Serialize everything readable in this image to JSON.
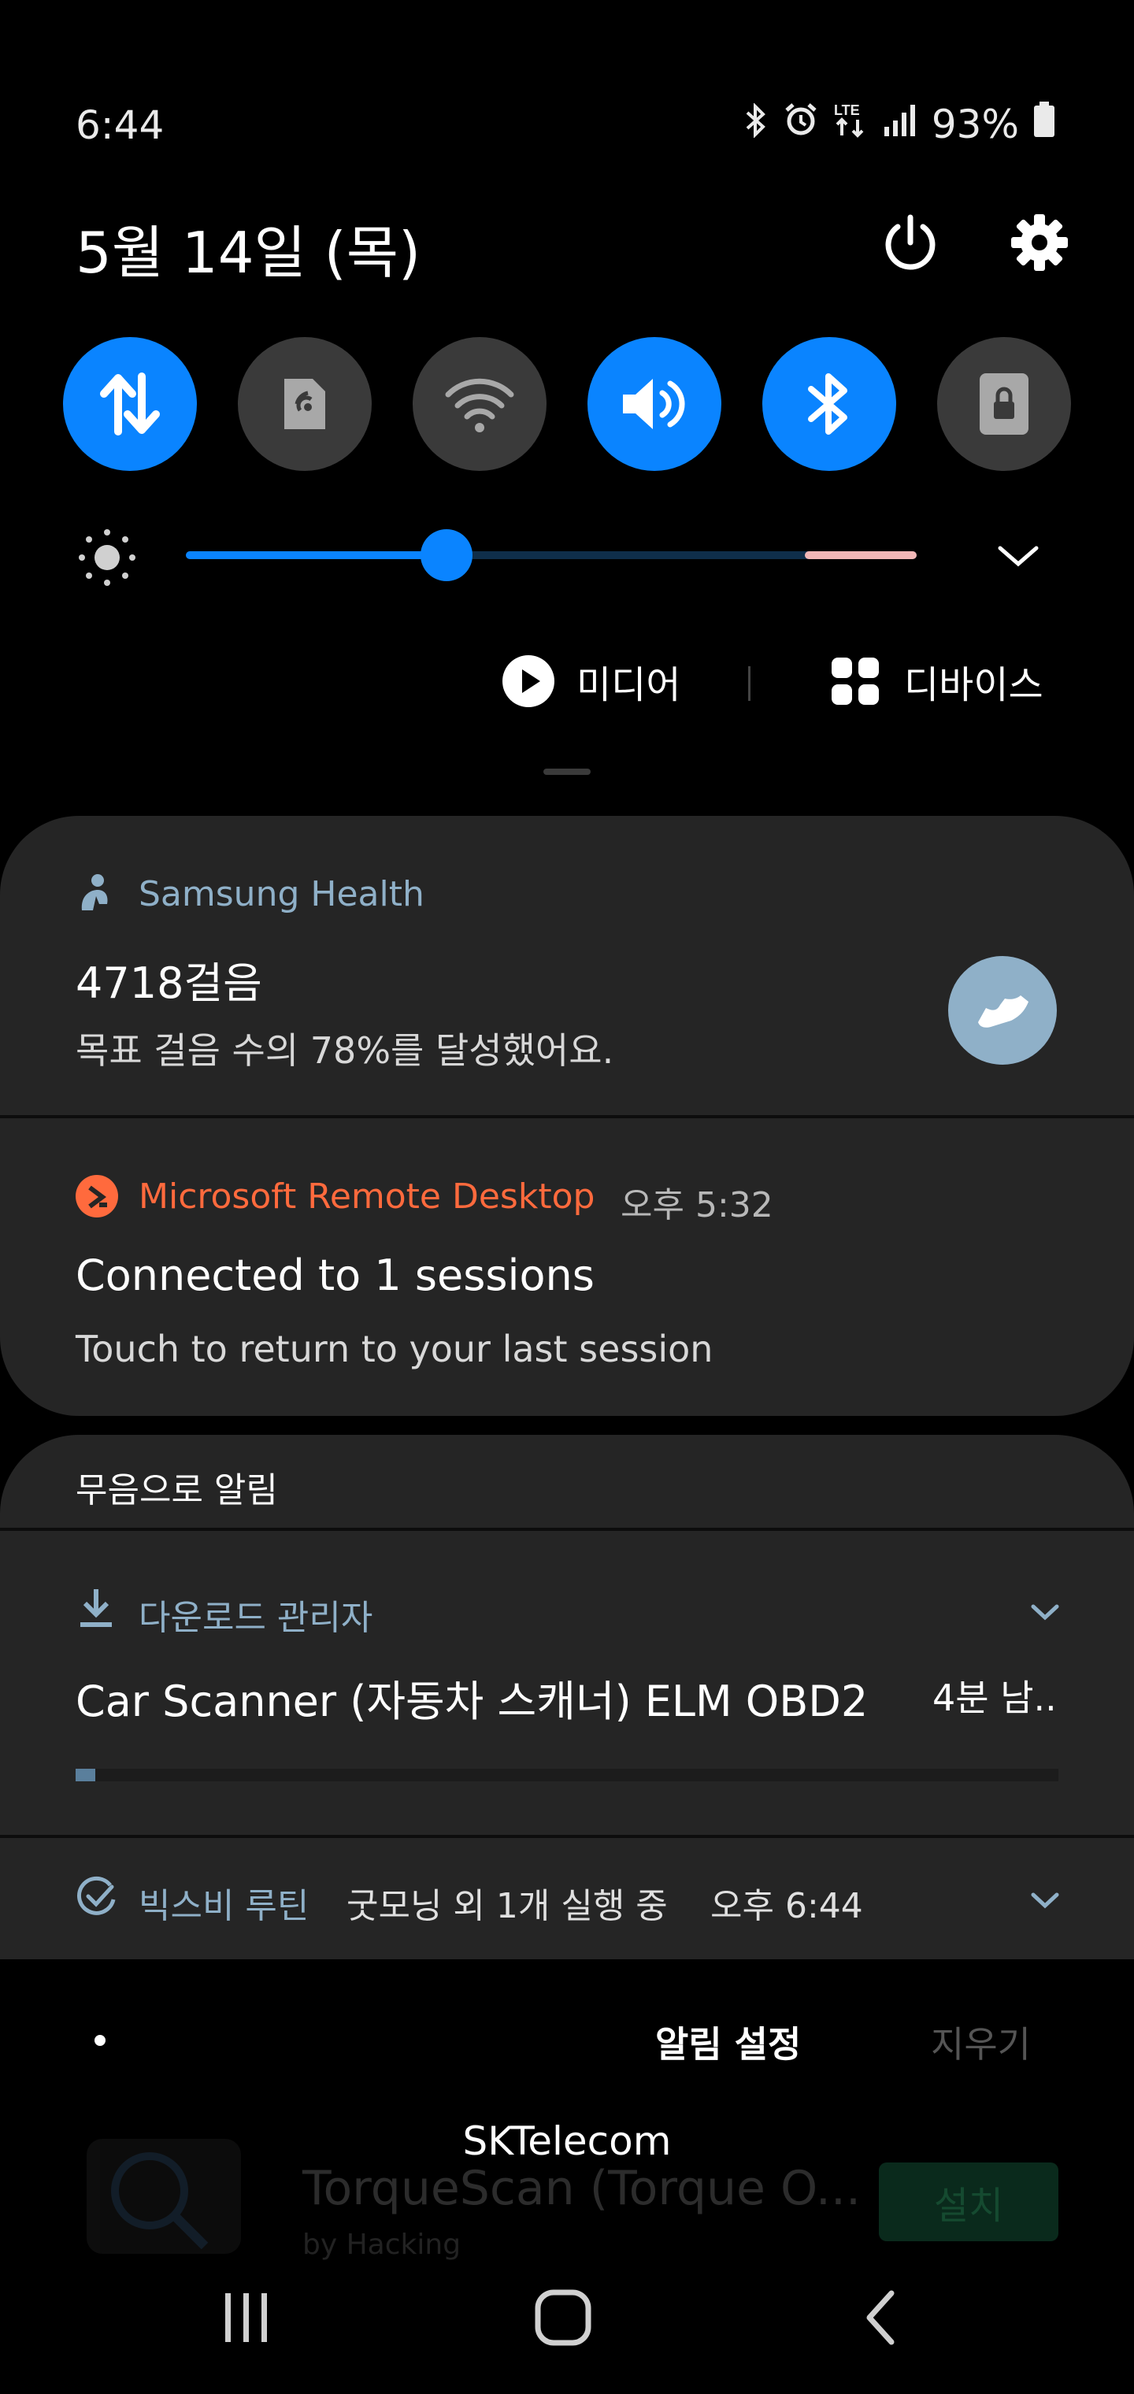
{
  "status": {
    "time": "6:44",
    "battery": "93%"
  },
  "header": {
    "date": "5월 14일 (목)"
  },
  "quick_settings": [
    {
      "name": "mobile-data",
      "state": "on"
    },
    {
      "name": "nfc",
      "state": "off"
    },
    {
      "name": "wifi",
      "state": "off"
    },
    {
      "name": "sound",
      "state": "on"
    },
    {
      "name": "bluetooth",
      "state": "on"
    },
    {
      "name": "screen-lock",
      "state": "off"
    }
  ],
  "brightness": {
    "level": 0.36
  },
  "media_row": {
    "media_label": "미디어",
    "devices_label": "디바이스"
  },
  "notifications": {
    "health": {
      "app": "Samsung Health",
      "title": "4718걸음",
      "body": "목표 걸음 수의 78%를 달성했어요."
    },
    "remote": {
      "app": "Microsoft Remote Desktop",
      "time": "오후 5:32",
      "title": "Connected to 1 sessions",
      "body": "Touch to return to your last session"
    },
    "silent_header": "무음으로 알림",
    "download": {
      "app": "다운로드 관리자",
      "title": "Car Scanner (자동차 스캐너) ELM OBD2",
      "remaining": "4분 남..",
      "progress": 0.02
    },
    "bixby": {
      "app": "빅스비 루틴",
      "body": "굿모닝 외 1개 실행 중",
      "time": "오후 6:44"
    }
  },
  "footer": {
    "settings_label": "알림 설정",
    "clear_label": "지우기"
  },
  "background_ad": {
    "title": "TorqueScan (Torque O...",
    "subtitle": "by Hacking",
    "install": "설치"
  },
  "carrier": "SKTelecom",
  "colors": {
    "accent": "#0a84ff",
    "remote": "#ff6a3d",
    "health_blue": "#8fb0c8"
  }
}
